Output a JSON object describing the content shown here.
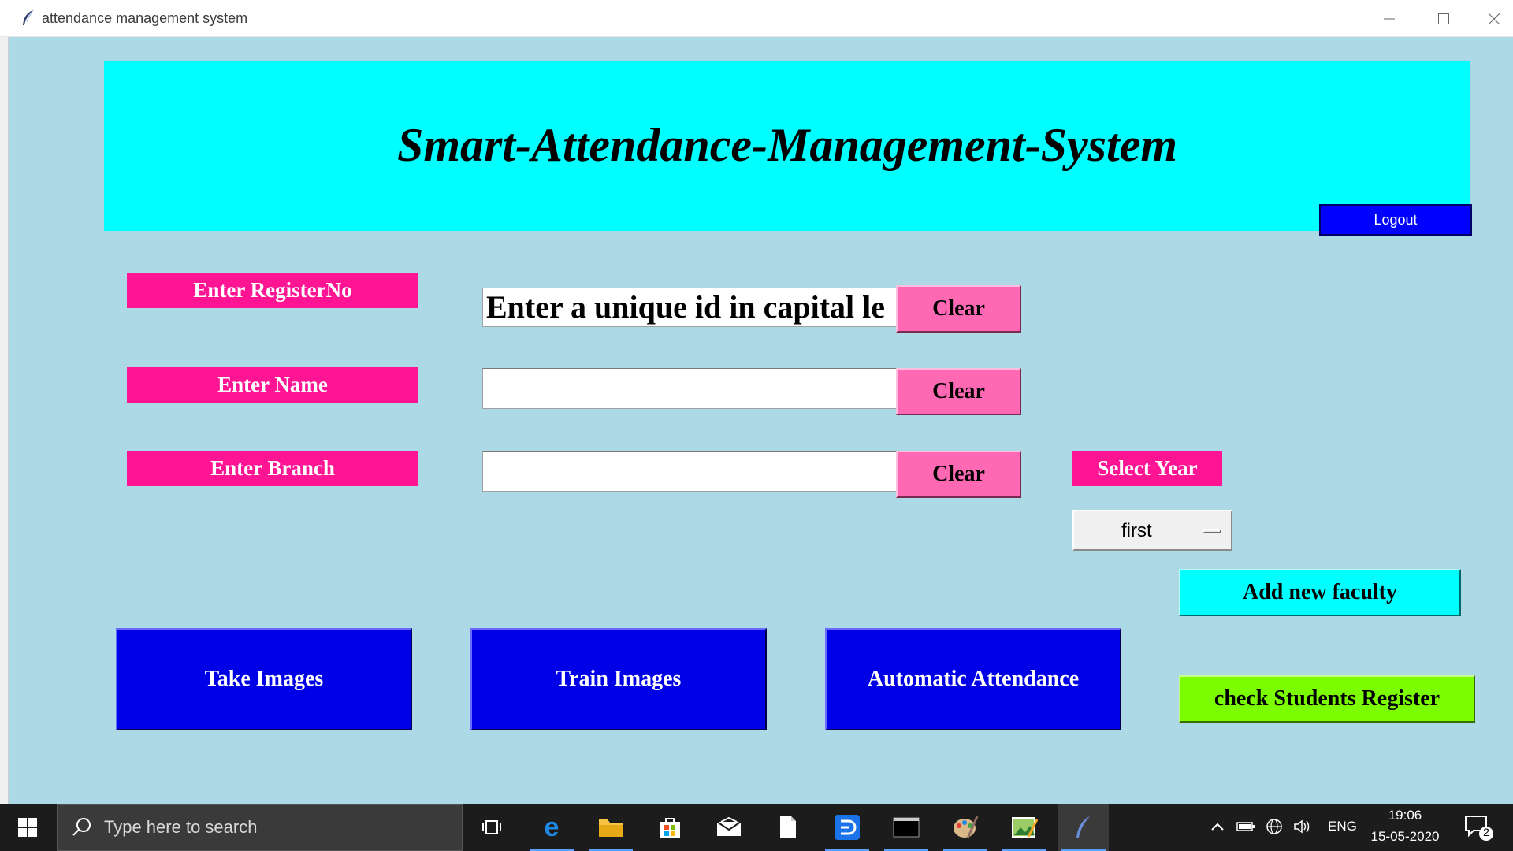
{
  "window": {
    "title": "attendance management system"
  },
  "header": {
    "title": "Smart-Attendance-Management-System",
    "logout_label": "Logout"
  },
  "form": {
    "register_label": "Enter RegisterNo",
    "register_value": "Enter a unique id in capital le",
    "name_label": "Enter Name",
    "name_value": "",
    "branch_label": "Enter Branch",
    "branch_value": "",
    "clear_label": "Clear",
    "year_label": "Select Year",
    "year_selected": "first"
  },
  "actions": {
    "add_faculty": "Add new faculty",
    "take_images": "Take Images",
    "train_images": "Train Images",
    "automatic_attendance": "Automatic Attendance",
    "check_register": "check Students Register"
  },
  "taskbar": {
    "search_placeholder": "Type here to search",
    "language": "ENG",
    "time": "19:06",
    "date": "15-05-2020",
    "notification_count": "2",
    "apps": [
      "task-view-icon",
      "edge-icon",
      "file-explorer-icon",
      "store-icon",
      "mail-icon",
      "notepad-icon",
      "app-icon",
      "terminal-icon",
      "paint-icon",
      "image-editor-icon",
      "python-feather-icon"
    ]
  },
  "colors": {
    "background": "#add8e6",
    "banner": "#00ffff",
    "label_pink": "#ff1493",
    "clear_pink": "#ff69b4",
    "action_blue": "#0000e6",
    "register_green": "#7cfc00",
    "logout_blue": "#0000ff"
  }
}
